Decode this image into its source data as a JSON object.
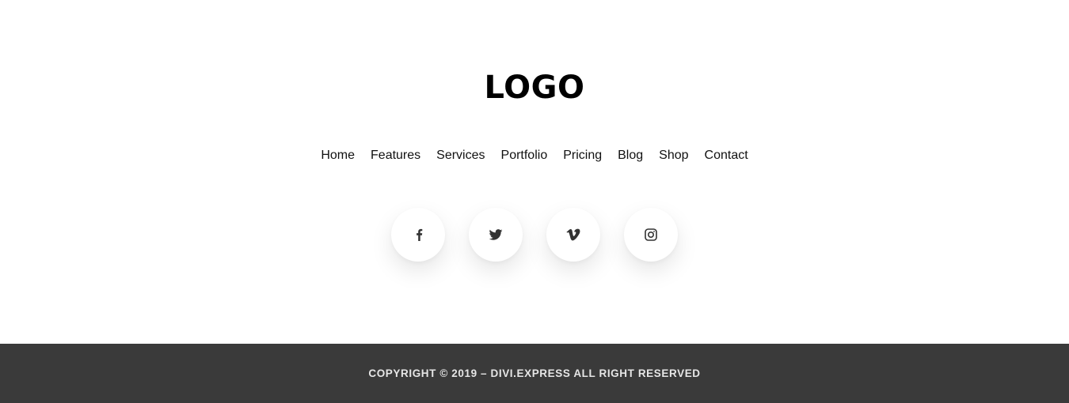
{
  "logo": {
    "text": "LOGO"
  },
  "nav": {
    "items": [
      {
        "label": "Home"
      },
      {
        "label": "Features"
      },
      {
        "label": "Services"
      },
      {
        "label": "Portfolio"
      },
      {
        "label": "Pricing"
      },
      {
        "label": "Blog"
      },
      {
        "label": "Shop"
      },
      {
        "label": "Contact"
      }
    ]
  },
  "social": {
    "icons": [
      "facebook-icon",
      "twitter-icon",
      "vimeo-icon",
      "instagram-icon"
    ]
  },
  "copyright": {
    "text": "COPYRIGHT © 2019 – DIVI.EXPRESS ALL RIGHT RESERVED"
  },
  "colors": {
    "background": "#ffffff",
    "text": "#111111",
    "copyright_bar": "#3a3a3a",
    "copyright_text": "#e6e6e6"
  }
}
